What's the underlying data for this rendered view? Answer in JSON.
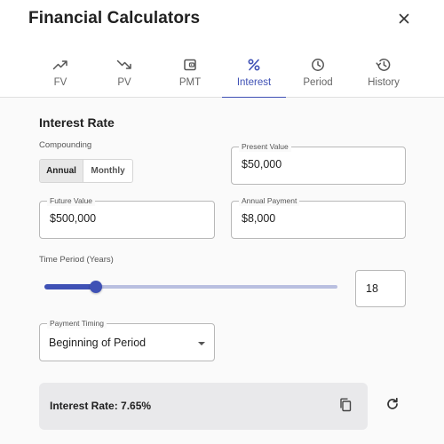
{
  "header": {
    "title": "Financial Calculators",
    "close_icon": "close-icon"
  },
  "tabs": [
    {
      "label": "FV",
      "icon": "trending-up-icon"
    },
    {
      "label": "PV",
      "icon": "trending-down-icon"
    },
    {
      "label": "PMT",
      "icon": "wallet-icon"
    },
    {
      "label": "Interest",
      "icon": "percent-icon",
      "active": true
    },
    {
      "label": "Period",
      "icon": "clock-icon"
    },
    {
      "label": "History",
      "icon": "history-icon"
    }
  ],
  "colors": {
    "accent": "#3f51b5",
    "rail": "#b9bfe0",
    "result_bg": "#e9e9eb"
  },
  "form": {
    "section_title": "Interest Rate",
    "compounding": {
      "label": "Compounding",
      "options": [
        "Annual",
        "Monthly"
      ],
      "selected": "Annual"
    },
    "present_value": {
      "label": "Present Value",
      "value": "$50,000"
    },
    "future_value": {
      "label": "Future Value",
      "value": "$500,000"
    },
    "annual_payment": {
      "label": "Annual Payment",
      "value": "$8,000"
    },
    "time_period": {
      "label": "Time Period (Years)",
      "value": "18",
      "slider_fraction": 0.175
    },
    "payment_timing": {
      "label": "Payment Timing",
      "value": "Beginning of Period"
    }
  },
  "result": {
    "text": "Interest Rate: 7.65%",
    "copy_icon": "copy-icon",
    "refresh_icon": "refresh-icon"
  }
}
